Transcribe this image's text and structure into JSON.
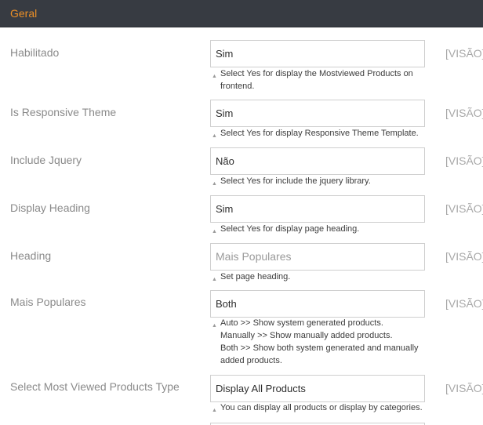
{
  "section": {
    "title": "Geral"
  },
  "scope_label": "[VISÃO]",
  "note_arrow": "▲",
  "rows": [
    {
      "label": "Habilitado",
      "value": "Sim",
      "note": [
        "Select Yes for display the Mostviewed Products on",
        "frontend."
      ]
    },
    {
      "label": "Is Responsive Theme",
      "value": "Sim",
      "note": [
        "Select Yes for display Responsive Theme Template."
      ]
    },
    {
      "label": "Include Jquery",
      "value": "Não",
      "note": [
        "Select Yes for include the jquery library."
      ]
    },
    {
      "label": "Display Heading",
      "value": "Sim",
      "note": [
        "Select Yes for display page heading."
      ]
    },
    {
      "label": "Heading",
      "value": "Mais Populares",
      "note": [
        "Set page heading."
      ]
    },
    {
      "label": "Mais Populares",
      "value": "Both",
      "note": [
        "Auto >> Show system generated products.",
        "Manually >> Show manually added products.",
        "Both >> Show both system generated and manually",
        "added products."
      ]
    },
    {
      "label": "Select Most Viewed Products Type",
      "value": "Display All Products",
      "note": [
        "You can display all products or display by categories."
      ]
    }
  ]
}
